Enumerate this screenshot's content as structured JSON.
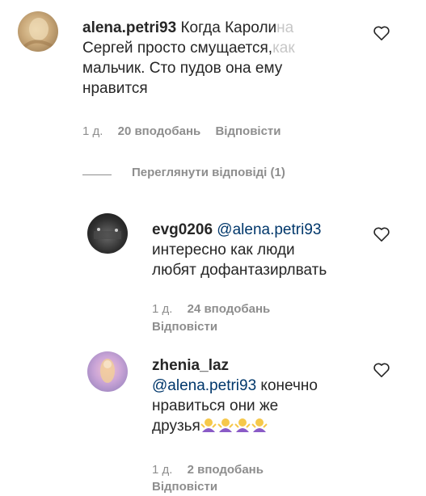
{
  "comments": [
    {
      "username": "alena.petri93",
      "text": " Когда Кароли… Сергей просто смущается, как мальчик. Сто пудов она ему нравится",
      "line1": " Когда Кароли",
      "line2": "Сергей просто смущается,",
      "line2b": "как",
      "line3": "мальчик. Сто пудов она ему",
      "line4": "нравится",
      "time": "1 д.",
      "likes": "20 вподобань",
      "reply": "Відповісти"
    },
    {
      "username": "evg0206",
      "mention": "@alena.petri93",
      "line1": "интересно как люди",
      "line2": "любят дофантазирлвать",
      "time": "1 д.",
      "likes": "24 вподобань",
      "reply": "Відповісти"
    },
    {
      "username": "zhenia_laz",
      "mention": "@alena.petri93",
      "line1tail": " конечно",
      "line2": "нравиться они же",
      "line3": "друзья",
      "time": "1 д.",
      "likes": "2 вподобань",
      "reply": "Відповісти"
    }
  ],
  "view_replies": "Переглянути відповіді (1)",
  "icons": {
    "like": "heart-outline-icon",
    "emoji": "person-shrugging-emoji"
  },
  "colors": {
    "mention": "#00376b",
    "meta": "#8e8e8e",
    "text": "#262626"
  }
}
